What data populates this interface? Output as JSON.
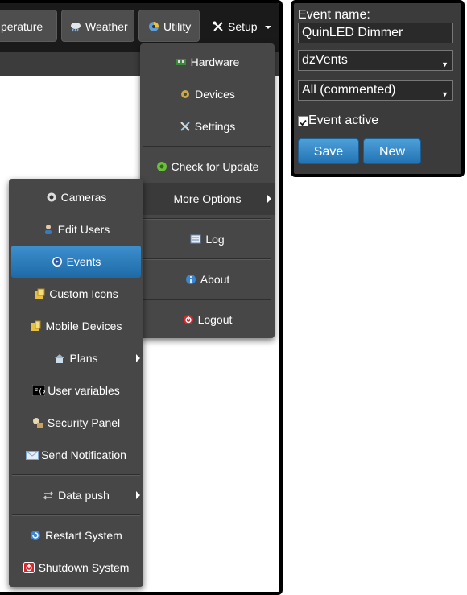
{
  "topnav": {
    "tabs": [
      {
        "label": "perature",
        "icon": "thermometer-icon"
      },
      {
        "label": "Weather",
        "icon": "cloud-rain-icon"
      },
      {
        "label": "Utility",
        "icon": "utility-icon"
      },
      {
        "label": "Setup",
        "icon": "tools-icon",
        "active": true
      }
    ]
  },
  "setup_menu": {
    "items": [
      {
        "label": "Hardware",
        "icon": "hardware-icon"
      },
      {
        "label": "Devices",
        "icon": "devices-gear-icon"
      },
      {
        "label": "Settings",
        "icon": "wrench-icon"
      },
      {
        "label": "Check for Update",
        "icon": "update-icon"
      },
      {
        "label": "More Options",
        "icon": "",
        "submenu": true
      },
      {
        "label": "Log",
        "icon": "log-icon"
      },
      {
        "label": "About",
        "icon": "info-icon"
      },
      {
        "label": "Logout",
        "icon": "power-icon"
      }
    ]
  },
  "more_options_menu": {
    "items": [
      {
        "label": "Cameras",
        "icon": "camera-icon"
      },
      {
        "label": "Edit Users",
        "icon": "users-icon"
      },
      {
        "label": "Events",
        "icon": "events-icon",
        "selected": true
      },
      {
        "label": "Custom Icons",
        "icon": "custom-icons-icon"
      },
      {
        "label": "Mobile Devices",
        "icon": "mobile-devices-icon"
      },
      {
        "label": "Plans",
        "icon": "house-icon",
        "submenu": true
      },
      {
        "label": "User variables",
        "icon": "fx-icon"
      },
      {
        "label": "Security Panel",
        "icon": "security-icon"
      },
      {
        "label": "Send Notification",
        "icon": "envelope-icon"
      },
      {
        "label": "Data push",
        "icon": "data-push-icon",
        "submenu": true
      },
      {
        "label": "Restart System",
        "icon": "restart-icon"
      },
      {
        "label": "Shutdown System",
        "icon": "shutdown-icon"
      }
    ]
  },
  "event_panel": {
    "name_label": "Event name:",
    "name_value": "QuinLED Dimmer",
    "type_value": "dzVents",
    "template_value": "All (commented)",
    "active_label": "Event active",
    "active_checked": true,
    "save_label": "Save",
    "new_label": "New"
  },
  "colors": {
    "nav_bg": "#1a1a1a",
    "menu_bg": "#474747",
    "panel_bg": "#3b3b3b",
    "accent_blue": "#2273b3"
  }
}
